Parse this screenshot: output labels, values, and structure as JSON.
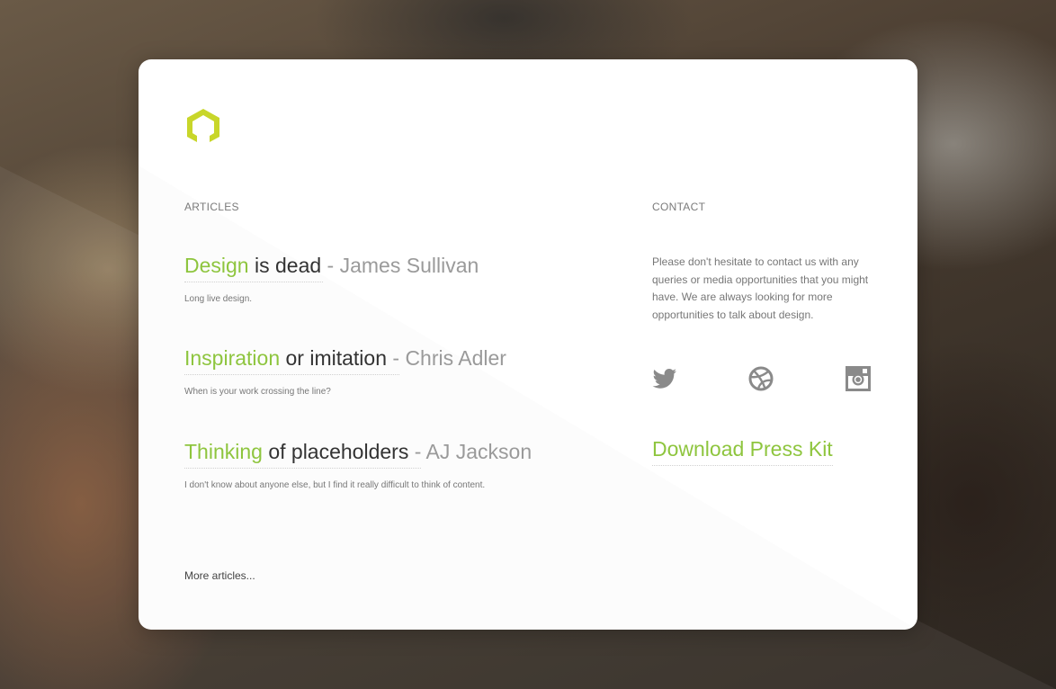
{
  "colors": {
    "accent": "#8ec53e",
    "logo": "#c8d62a",
    "text_dark": "#333333",
    "text_muted": "#9a9a9a",
    "icon": "#8a8a8a"
  },
  "logo": {
    "icon": "hexagon-logo-icon"
  },
  "articles": {
    "label": "ARTICLES",
    "items": [
      {
        "highlight": "Design",
        "rest": " is dead",
        "author": " - James Sullivan",
        "description": "Long live design."
      },
      {
        "highlight": "Inspiration",
        "rest": " or imitation",
        "author": " - Chris Adler",
        "description": "When is your work crossing the line?"
      },
      {
        "highlight": "Thinking",
        "rest": " of placeholders",
        "author": " - AJ Jackson",
        "description": "I don't know about anyone else, but I find it really difficult to think of content."
      }
    ],
    "more": "More articles..."
  },
  "contact": {
    "label": "CONTACT",
    "text": "Please don't hesitate to contact us with any queries or media opportunities that you might have. We are always looking for more opportunities to talk about design.",
    "social": [
      {
        "icon": "twitter-icon"
      },
      {
        "icon": "dribbble-icon"
      },
      {
        "icon": "instagram-icon"
      }
    ],
    "press_kit": "Download Press Kit"
  }
}
